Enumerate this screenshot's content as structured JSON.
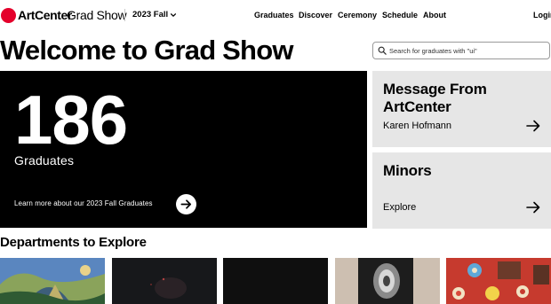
{
  "brand": {
    "name": "ArtCenter",
    "product": "Grad Show",
    "accent_color": "#e4002b"
  },
  "term_select": {
    "value": "2023 Fall"
  },
  "nav": {
    "items": [
      "Graduates",
      "Discover",
      "Ceremony",
      "Schedule",
      "About"
    ],
    "login_label": "Login"
  },
  "page_title": "Welcome to Grad Show",
  "search": {
    "placeholder": "Search for graduates with \"ui\""
  },
  "hero": {
    "count": "186",
    "count_label": "Graduates",
    "link_text": "Learn more about our 2023 Fall Graduates"
  },
  "cards": [
    {
      "title": "Message From ArtCenter",
      "subtitle": "Karen Hofmann"
    },
    {
      "title": "Minors",
      "subtitle": "Explore"
    }
  ],
  "departments": {
    "heading": "Departments to Explore"
  }
}
